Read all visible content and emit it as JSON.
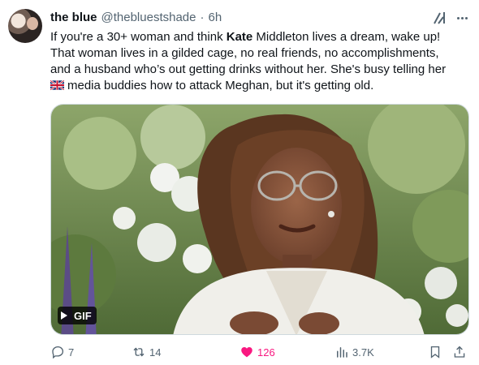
{
  "tweet": {
    "display_name": "the blue",
    "handle": "@thebluestshade",
    "separator": "·",
    "time": "6h",
    "text": {
      "line1_pre": "If you're a 30+ woman and think ",
      "line1_bold": "Kate",
      "line1_post": " Middleton lives a dream, wake up!",
      "line2": "That woman lives in a gilded cage, no real friends, no accomplishments,",
      "line3": "and a husband who’s out getting drinks without her. She's busy telling her",
      "line4": "media buddies how to attack Meghan, but it's getting old."
    },
    "media": {
      "badge_label": "GIF",
      "type": "gif"
    }
  },
  "actions": {
    "replies": "7",
    "reposts": "14",
    "likes": "126",
    "views": "3.7K"
  },
  "icons": {
    "grok": "grok-icon",
    "more": "more-icon",
    "reply": "reply-icon",
    "repost": "repost-icon",
    "like": "heart-icon",
    "views": "views-icon",
    "bookmark": "bookmark-icon",
    "share": "share-icon",
    "flag": "uk-flag-icon",
    "play": "play-icon"
  },
  "colors": {
    "text": "#0f1419",
    "muted": "#536471",
    "like": "#f91880",
    "border": "#cfd9de"
  }
}
